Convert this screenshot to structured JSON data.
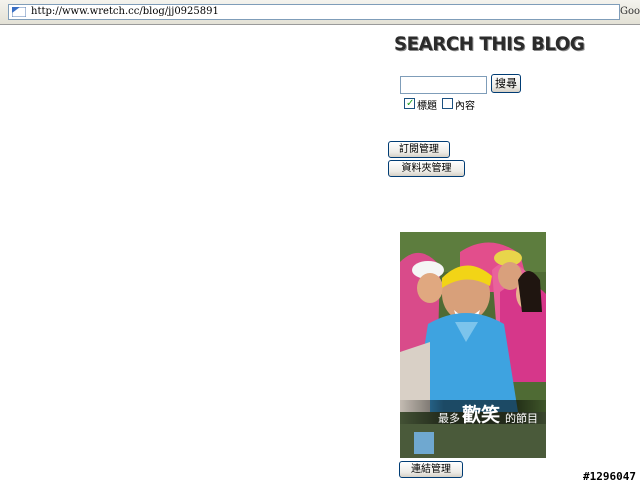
{
  "browser": {
    "url": "http://www.wretch.cc/blog/jj0925891",
    "search_engine_partial": "Goo"
  },
  "sidebar": {
    "search_heading": "SEARCH THIS BLOG",
    "search": {
      "value": "",
      "button_label": "搜尋",
      "options": [
        {
          "label": "標題",
          "checked": true
        },
        {
          "label": "內容",
          "checked": false
        }
      ]
    },
    "subscribe_button": "訂閱管理",
    "folder_button": "資料夾管理",
    "photo_caption": {
      "prefix": "最多",
      "emphasis": "歡笑",
      "suffix": "的節目"
    },
    "links_button": "連結管理"
  },
  "overlay": {
    "image_id": "#1296047"
  },
  "colors": {
    "border_blue": "#003c74",
    "check_green": "#21a121"
  }
}
